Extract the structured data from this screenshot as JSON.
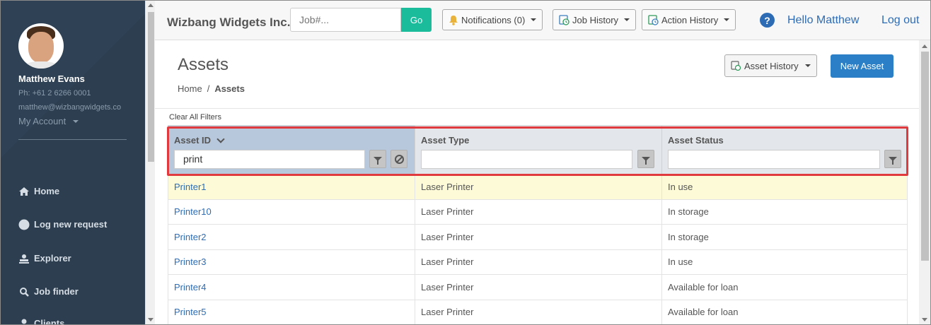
{
  "user": {
    "name": "Matthew Evans",
    "phone": "Ph: +61 2 6266 0001",
    "email": "matthew@wizbangwidgets.co",
    "account_label": "My Account"
  },
  "sidebar": {
    "items": [
      {
        "label": "Home",
        "icon": "home-icon"
      },
      {
        "label": "Log new request",
        "icon": "circle-icon"
      },
      {
        "label": "Explorer",
        "icon": "explorer-icon"
      },
      {
        "label": "Job finder",
        "icon": "magnifier-icon"
      },
      {
        "label": "Clients",
        "icon": "person-icon"
      }
    ]
  },
  "topbar": {
    "company": "Wizbang Widgets Inc.",
    "job_placeholder": "Job#...",
    "go_label": "Go",
    "notifications_label": "Notifications (0)",
    "job_history_label": "Job History",
    "action_history_label": "Action History",
    "hello": "Hello Matthew",
    "logout": "Log out"
  },
  "page": {
    "title": "Assets",
    "breadcrumb": {
      "home": "Home",
      "separator": "/",
      "current": "Assets"
    },
    "asset_history_label": "Asset History",
    "new_asset_label": "New Asset",
    "clear_filters": "Clear All Filters"
  },
  "grid": {
    "columns": [
      {
        "title": "Asset ID",
        "filter_value": "print"
      },
      {
        "title": "Asset Type",
        "filter_value": ""
      },
      {
        "title": "Asset Status",
        "filter_value": ""
      }
    ],
    "rows": [
      {
        "id": "Printer1",
        "type": "Laser Printer",
        "status": "In use"
      },
      {
        "id": "Printer10",
        "type": "Laser Printer",
        "status": "In storage"
      },
      {
        "id": "Printer2",
        "type": "Laser Printer",
        "status": "In storage"
      },
      {
        "id": "Printer3",
        "type": "Laser Printer",
        "status": "In use"
      },
      {
        "id": "Printer4",
        "type": "Laser Printer",
        "status": "Available for loan"
      },
      {
        "id": "Printer5",
        "type": "Laser Printer",
        "status": "Available for loan"
      }
    ]
  },
  "colors": {
    "sidebar_bg": "#2c3e50",
    "accent_green": "#1abc9c",
    "accent_blue": "#2a7fc6",
    "highlight_red": "#e0393e",
    "selected_row": "#fdfbd7"
  }
}
